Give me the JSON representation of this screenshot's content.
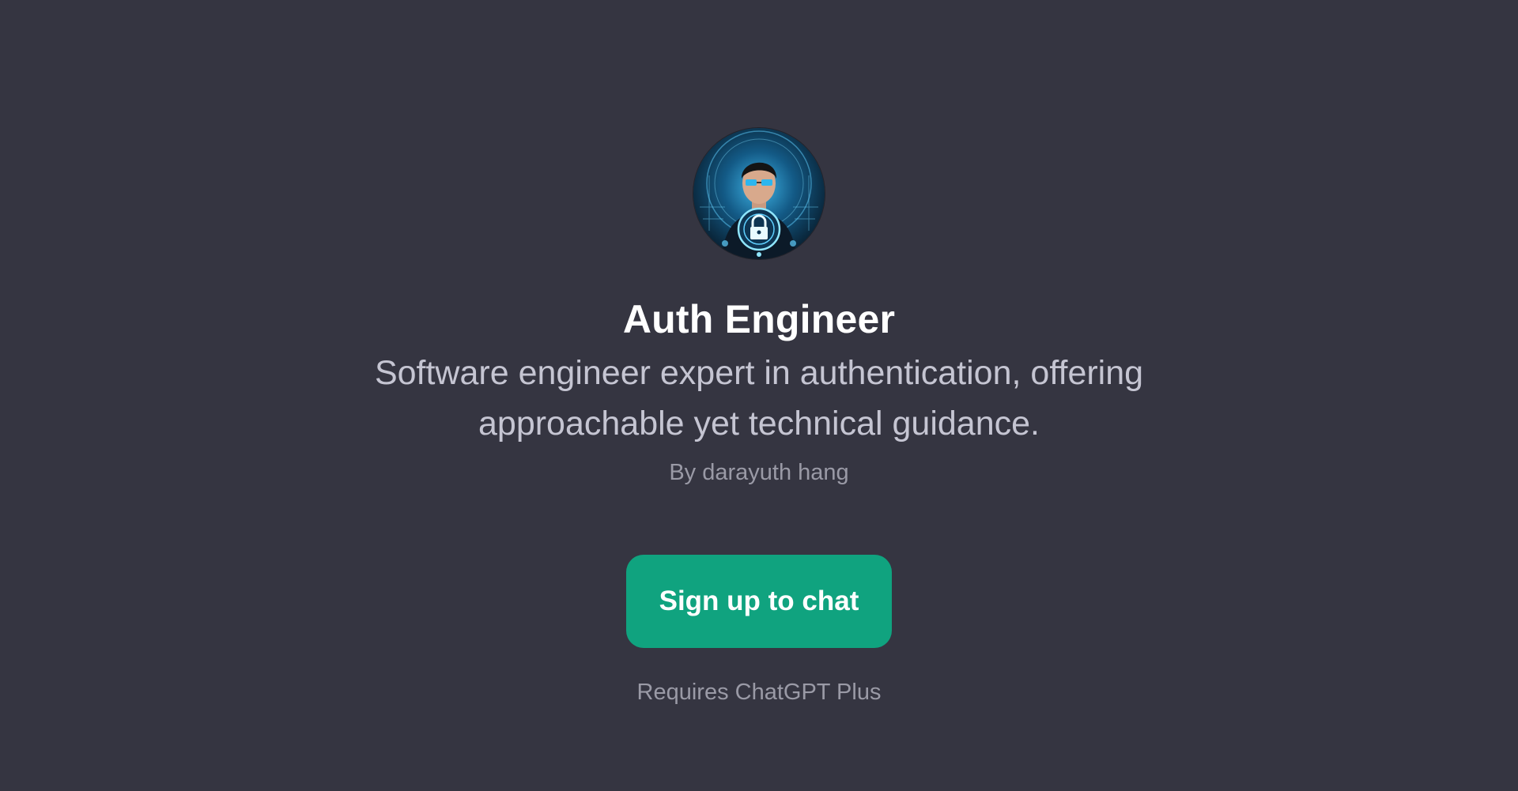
{
  "gpt": {
    "avatar_icon": "security-engineer-portrait-icon",
    "name": "Auth Engineer",
    "description": "Software engineer expert in authentication, offering approachable yet technical guidance.",
    "author": "By darayuth hang"
  },
  "actions": {
    "signup_label": "Sign up to chat"
  },
  "footer": {
    "requirement": "Requires ChatGPT Plus"
  },
  "colors": {
    "background": "#353541",
    "accent": "#10a37f",
    "title": "#ffffff",
    "description": "#c5c5d2",
    "muted": "#9a9aa6"
  }
}
